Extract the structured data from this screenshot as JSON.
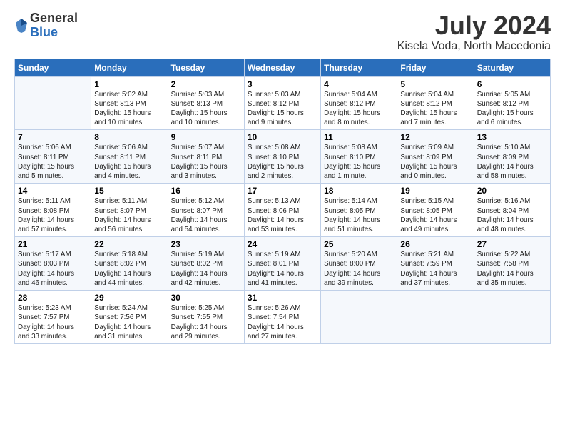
{
  "logo": {
    "general": "General",
    "blue": "Blue"
  },
  "title": "July 2024",
  "subtitle": "Kisela Voda, North Macedonia",
  "headers": [
    "Sunday",
    "Monday",
    "Tuesday",
    "Wednesday",
    "Thursday",
    "Friday",
    "Saturday"
  ],
  "weeks": [
    [
      {
        "day": "",
        "info": ""
      },
      {
        "day": "1",
        "info": "Sunrise: 5:02 AM\nSunset: 8:13 PM\nDaylight: 15 hours\nand 10 minutes."
      },
      {
        "day": "2",
        "info": "Sunrise: 5:03 AM\nSunset: 8:13 PM\nDaylight: 15 hours\nand 10 minutes."
      },
      {
        "day": "3",
        "info": "Sunrise: 5:03 AM\nSunset: 8:12 PM\nDaylight: 15 hours\nand 9 minutes."
      },
      {
        "day": "4",
        "info": "Sunrise: 5:04 AM\nSunset: 8:12 PM\nDaylight: 15 hours\nand 8 minutes."
      },
      {
        "day": "5",
        "info": "Sunrise: 5:04 AM\nSunset: 8:12 PM\nDaylight: 15 hours\nand 7 minutes."
      },
      {
        "day": "6",
        "info": "Sunrise: 5:05 AM\nSunset: 8:12 PM\nDaylight: 15 hours\nand 6 minutes."
      }
    ],
    [
      {
        "day": "7",
        "info": "Sunrise: 5:06 AM\nSunset: 8:11 PM\nDaylight: 15 hours\nand 5 minutes."
      },
      {
        "day": "8",
        "info": "Sunrise: 5:06 AM\nSunset: 8:11 PM\nDaylight: 15 hours\nand 4 minutes."
      },
      {
        "day": "9",
        "info": "Sunrise: 5:07 AM\nSunset: 8:11 PM\nDaylight: 15 hours\nand 3 minutes."
      },
      {
        "day": "10",
        "info": "Sunrise: 5:08 AM\nSunset: 8:10 PM\nDaylight: 15 hours\nand 2 minutes."
      },
      {
        "day": "11",
        "info": "Sunrise: 5:08 AM\nSunset: 8:10 PM\nDaylight: 15 hours\nand 1 minute."
      },
      {
        "day": "12",
        "info": "Sunrise: 5:09 AM\nSunset: 8:09 PM\nDaylight: 15 hours\nand 0 minutes."
      },
      {
        "day": "13",
        "info": "Sunrise: 5:10 AM\nSunset: 8:09 PM\nDaylight: 14 hours\nand 58 minutes."
      }
    ],
    [
      {
        "day": "14",
        "info": "Sunrise: 5:11 AM\nSunset: 8:08 PM\nDaylight: 14 hours\nand 57 minutes."
      },
      {
        "day": "15",
        "info": "Sunrise: 5:11 AM\nSunset: 8:07 PM\nDaylight: 14 hours\nand 56 minutes."
      },
      {
        "day": "16",
        "info": "Sunrise: 5:12 AM\nSunset: 8:07 PM\nDaylight: 14 hours\nand 54 minutes."
      },
      {
        "day": "17",
        "info": "Sunrise: 5:13 AM\nSunset: 8:06 PM\nDaylight: 14 hours\nand 53 minutes."
      },
      {
        "day": "18",
        "info": "Sunrise: 5:14 AM\nSunset: 8:05 PM\nDaylight: 14 hours\nand 51 minutes."
      },
      {
        "day": "19",
        "info": "Sunrise: 5:15 AM\nSunset: 8:05 PM\nDaylight: 14 hours\nand 49 minutes."
      },
      {
        "day": "20",
        "info": "Sunrise: 5:16 AM\nSunset: 8:04 PM\nDaylight: 14 hours\nand 48 minutes."
      }
    ],
    [
      {
        "day": "21",
        "info": "Sunrise: 5:17 AM\nSunset: 8:03 PM\nDaylight: 14 hours\nand 46 minutes."
      },
      {
        "day": "22",
        "info": "Sunrise: 5:18 AM\nSunset: 8:02 PM\nDaylight: 14 hours\nand 44 minutes."
      },
      {
        "day": "23",
        "info": "Sunrise: 5:19 AM\nSunset: 8:02 PM\nDaylight: 14 hours\nand 42 minutes."
      },
      {
        "day": "24",
        "info": "Sunrise: 5:19 AM\nSunset: 8:01 PM\nDaylight: 14 hours\nand 41 minutes."
      },
      {
        "day": "25",
        "info": "Sunrise: 5:20 AM\nSunset: 8:00 PM\nDaylight: 14 hours\nand 39 minutes."
      },
      {
        "day": "26",
        "info": "Sunrise: 5:21 AM\nSunset: 7:59 PM\nDaylight: 14 hours\nand 37 minutes."
      },
      {
        "day": "27",
        "info": "Sunrise: 5:22 AM\nSunset: 7:58 PM\nDaylight: 14 hours\nand 35 minutes."
      }
    ],
    [
      {
        "day": "28",
        "info": "Sunrise: 5:23 AM\nSunset: 7:57 PM\nDaylight: 14 hours\nand 33 minutes."
      },
      {
        "day": "29",
        "info": "Sunrise: 5:24 AM\nSunset: 7:56 PM\nDaylight: 14 hours\nand 31 minutes."
      },
      {
        "day": "30",
        "info": "Sunrise: 5:25 AM\nSunset: 7:55 PM\nDaylight: 14 hours\nand 29 minutes."
      },
      {
        "day": "31",
        "info": "Sunrise: 5:26 AM\nSunset: 7:54 PM\nDaylight: 14 hours\nand 27 minutes."
      },
      {
        "day": "",
        "info": ""
      },
      {
        "day": "",
        "info": ""
      },
      {
        "day": "",
        "info": ""
      }
    ]
  ]
}
